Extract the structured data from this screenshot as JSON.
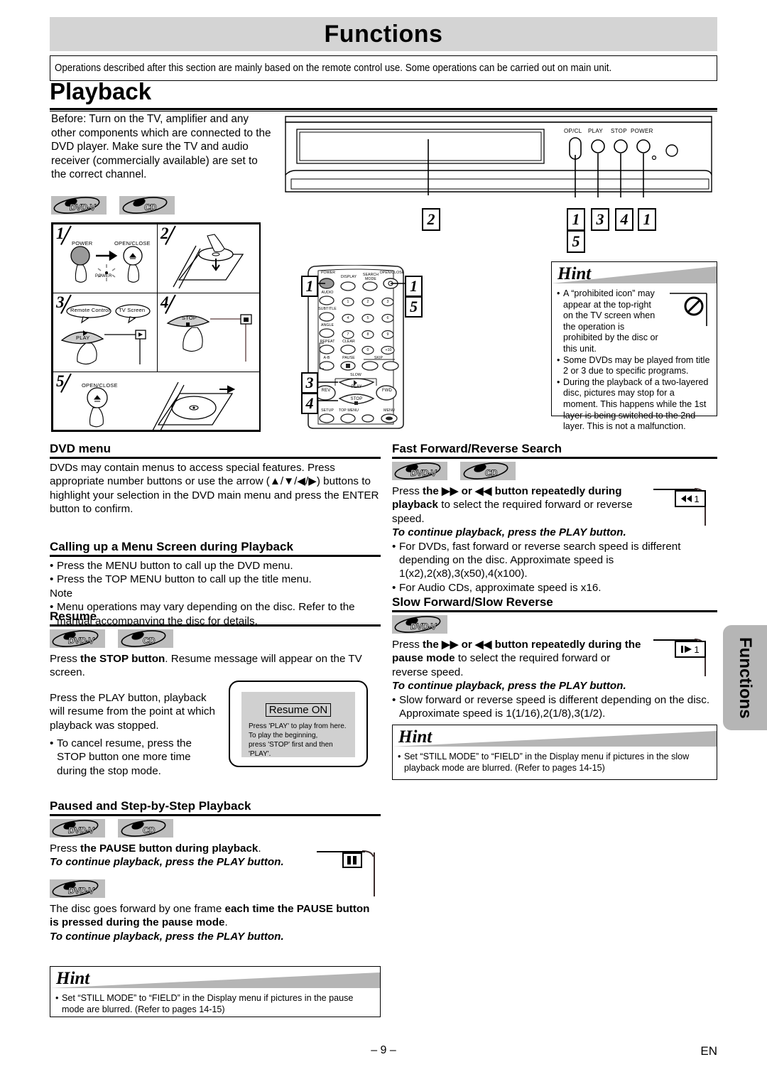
{
  "header": {
    "chapter": "Functions",
    "intro": "Operations described after this section are mainly based on the remote control use. Some operations can be carried out on main unit.",
    "section_title": "Playback"
  },
  "before": {
    "text": "Before: Turn on the TV, amplifier and any other components which are connected to the DVD player. Make sure the TV and audio receiver (commercially available) are set to the correct channel."
  },
  "badges": {
    "dvd": "DVD-V",
    "cd": "CD"
  },
  "steps": [
    {
      "num": "1",
      "labels": [
        "POWER",
        "OPEN/CLOSE",
        "POWER"
      ]
    },
    {
      "num": "2",
      "labels": []
    },
    {
      "num": "3",
      "labels": [
        "Remote Control",
        "TV Screen",
        "PLAY"
      ]
    },
    {
      "num": "4",
      "labels": [
        "STOP"
      ]
    },
    {
      "num": "5",
      "labels": [
        "OPEN/CLOSE"
      ]
    }
  ],
  "device": {
    "button_labels": [
      "OP/CL",
      "PLAY",
      "STOP",
      "POWER"
    ],
    "callouts": [
      "2",
      "1",
      "5",
      "3",
      "4",
      "1"
    ]
  },
  "remote": {
    "callouts": [
      "1",
      "1",
      "5",
      "3",
      "4"
    ],
    "labels": [
      "POWER",
      "DISPLAY",
      "SEARCH MODE",
      "OPEN/CLOSE",
      "AUDIO",
      "SUBTITLE",
      "ANGLE",
      "REPEAT",
      "CLEAR",
      "A-B",
      "PAUSE",
      "SKIP",
      "SLOW",
      "PLAY",
      "REV",
      "FWD",
      "STOP",
      "SETUP",
      "TOP MENU",
      "MENU"
    ],
    "numbers": [
      "1",
      "2",
      "3",
      "4",
      "5",
      "6",
      "7",
      "8",
      "9",
      "0",
      "+10"
    ]
  },
  "hint_top": {
    "title": "Hint",
    "items": [
      "A “prohibited icon” may appear at the top-right on the TV screen when the operation is prohibited by the disc or this unit.",
      "Some DVDs may be played from title 2 or 3 due to specific programs.",
      "During the playback of a two-layered disc, pictures may stop for a moment. This happens while the 1st layer is being switched to the 2nd layer. This is not a malfunction."
    ],
    "icon": "prohibited-icon"
  },
  "dvd_menu": {
    "title": "DVD menu",
    "body": "DVDs may contain menus to access special features. Press appropriate number buttons or use the arrow (▲/▼/◀/▶) buttons to highlight your selection in the DVD main menu and press the ENTER button to confirm."
  },
  "calling_menu": {
    "title": "Calling up a Menu Screen during Playback",
    "items": [
      "Press the MENU button to call up the DVD menu.",
      "Press the TOP MENU button to call up the title menu."
    ],
    "note_label": "Note",
    "note_items": [
      "Menu operations may vary depending on the disc. Refer to the manual accompanying the disc for details."
    ]
  },
  "resume": {
    "title": "Resume",
    "p1_pre": "Press ",
    "p1_bold": "the STOP button",
    "p1_post": ". Resume message will appear on the TV screen.",
    "p2": "Press the PLAY button, playback will resume from the point at which playback was stopped.",
    "bullet": "To cancel resume, press the STOP button one more time during the stop mode.",
    "screen": {
      "chip": "Resume ON",
      "lines": [
        "Press 'PLAY' to play from here.",
        "To play the beginning,",
        "press 'STOP' first and then 'PLAY'."
      ]
    }
  },
  "paused": {
    "title": "Paused and Step-by-Step Playback",
    "p1_pre": "Press ",
    "p1_bold": "the PAUSE button during playback",
    "p1_post": ".",
    "p1_italic": "To continue playback, press the PLAY button.",
    "p2_pre": "The disc goes forward by one frame ",
    "p2_bold": "each time the PAUSE button is pressed during the pause mode",
    "p2_post": ".",
    "p2_italic": "To continue playback, press the PLAY button.",
    "icon": "pause-icon"
  },
  "hint_bottom_left": {
    "title": "Hint",
    "items": [
      "Set “STILL MODE” to “FIELD” in the Display menu if pictures in the pause mode are blurred. (Refer to pages 14-15)"
    ]
  },
  "ff_search": {
    "title": "Fast Forward/Reverse Search",
    "p1_pre": "Press ",
    "p1_bold": "the ▶▶ or ◀◀ button repeatedly during playback",
    "p1_post": " to select the required forward or reverse speed.",
    "p1_italic": "To continue playback, press the PLAY button.",
    "items": [
      "For DVDs, fast forward or reverse search speed is different depending on the disc. Approximate speed is 1(x2),2(x8),3(x50),4(x100).",
      "For Audio CDs, approximate speed is x16."
    ],
    "icon": "rewind-icon",
    "icon_value": "1"
  },
  "slow": {
    "title": "Slow Forward/Slow Reverse",
    "p1_pre": "Press ",
    "p1_bold": "the ▶▶ or ◀◀ button repeatedly during the pause mode",
    "p1_post": " to select the required forward or reverse speed.",
    "p1_italic": "To continue playback, press the PLAY button.",
    "items": [
      "Slow forward or reverse speed is different depending on the disc. Approximate speed is 1(1/16),2(1/8),3(1/2)."
    ],
    "icon": "slow-play-icon",
    "icon_value": "1"
  },
  "hint_right": {
    "title": "Hint",
    "items": [
      "Set “STILL MODE”  to “FIELD” in the Display menu if pictures in the slow playback mode are blurred. (Refer to pages 14-15)"
    ]
  },
  "side_tab": {
    "label": "Functions"
  },
  "footer": {
    "page": "– 9 –",
    "lang": "EN"
  }
}
